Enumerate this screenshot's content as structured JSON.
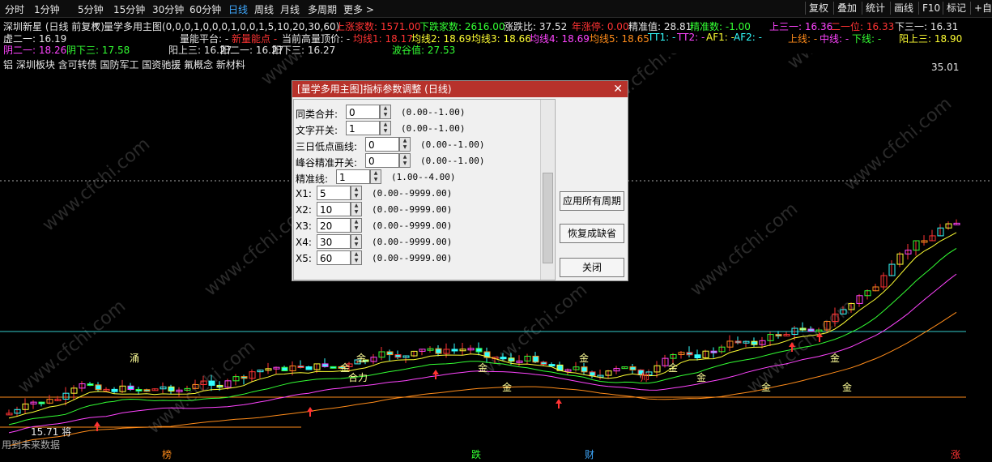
{
  "toolbar": {
    "periods": [
      "分时",
      "1分钟",
      "5分钟",
      "15分钟",
      "30分钟",
      "60分钟",
      "日线",
      "周线",
      "月线",
      "多周期",
      "更多 >"
    ],
    "active_index": 6,
    "right_buttons": [
      "复权",
      "叠加",
      "统计",
      "画线",
      "F10",
      "标记",
      "+自"
    ]
  },
  "header": {
    "stock": "深圳新星 (日线 前复权)",
    "indicator": "量学多用主图(0,0,0,1,0,0,0,1,0,0,1,5,10,20,30,60)",
    "up_count": "上涨家数: 1571.00",
    "down_count": "下跌家数: 2616.00",
    "ratio": "涨跌比: 37.52",
    "year_limit": "年涨停: 0.00",
    "precise": "精准值: 28.81",
    "precise_num": "精准数: -1.00",
    "up3": "上三一: 16.36",
    "two_one": "二一位: 16.33",
    "down3": "下三一: 16.31",
    "virtual21": "虚二一: 16.19",
    "energy": "量能平台: -",
    "new_energy": "新量能点 -",
    "current_high": "当前高量顶价: -",
    "ma1": "均线1: 18.17",
    "ma2": "均线2: 18.69",
    "ma3": "均线3: 18.66",
    "ma4": "均线4: 18.69",
    "ma5": "均线5: 18.65",
    "tt1": "TT1: -",
    "tt2": "TT2: -",
    "af1": "AF1: -",
    "af2": "AF2: -",
    "upper": "上线: -",
    "middle": "中线: -",
    "lower": "下线: -",
    "yang_up3": "阳上三: 18.90",
    "yin_down21": "阴二一: 18.26",
    "yin_down3": "阴下三: 17.58",
    "yang_up21": "阳上三: 16.27",
    "yang_21": "阳二一: 16.27",
    "yang_down3": "阳下三: 16.27",
    "wave": "波谷值: 27.53",
    "concepts": "铝 深圳板块 含可转债 国防军工 国资驰援 氟概念 新材料"
  },
  "chart": {
    "price_high_label": "35.01",
    "price_low_label": "15.71 将",
    "future_note": "用到未来数据",
    "bottom_tags": [
      {
        "text": "榜",
        "color": "#ff8c1a"
      },
      {
        "text": "跌",
        "color": "#33ff33"
      },
      {
        "text": "财",
        "color": "#3fa9ff"
      },
      {
        "text": "涨",
        "color": "#ff3333"
      }
    ],
    "annotations": [
      "金",
      "金",
      "合力",
      "金",
      "金",
      "金",
      "帅",
      "金",
      "金",
      "金",
      "金",
      "金",
      "涌"
    ]
  },
  "dialog": {
    "title": "[量学多用主图]指标参数调整 (日线)",
    "close": "✕",
    "params": [
      {
        "label": "同类合并:",
        "value": "0",
        "range": "(0.00--1.00)"
      },
      {
        "label": "文字开关:",
        "value": "1",
        "range": "(0.00--1.00)"
      },
      {
        "label": "三日低点画线:",
        "value": "0",
        "range": "(0.00--1.00)"
      },
      {
        "label": "峰谷精准开关:",
        "value": "0",
        "range": "(0.00--1.00)"
      },
      {
        "label": "精准线:",
        "value": "1",
        "range": "(1.00--4.00)"
      },
      {
        "label": "X1:",
        "value": "5",
        "range": "(0.00--9999.00)"
      },
      {
        "label": "X2:",
        "value": "10",
        "range": "(0.00--9999.00)"
      },
      {
        "label": "X3:",
        "value": "20",
        "range": "(0.00--9999.00)"
      },
      {
        "label": "X4:",
        "value": "30",
        "range": "(0.00--9999.00)"
      },
      {
        "label": "X5:",
        "value": "60",
        "range": "(0.00--9999.00)"
      }
    ],
    "apply_all": "应用所有周期",
    "restore": "恢复成缺省",
    "close_btn": "关闭"
  },
  "watermark": "www.cfchi.com"
}
